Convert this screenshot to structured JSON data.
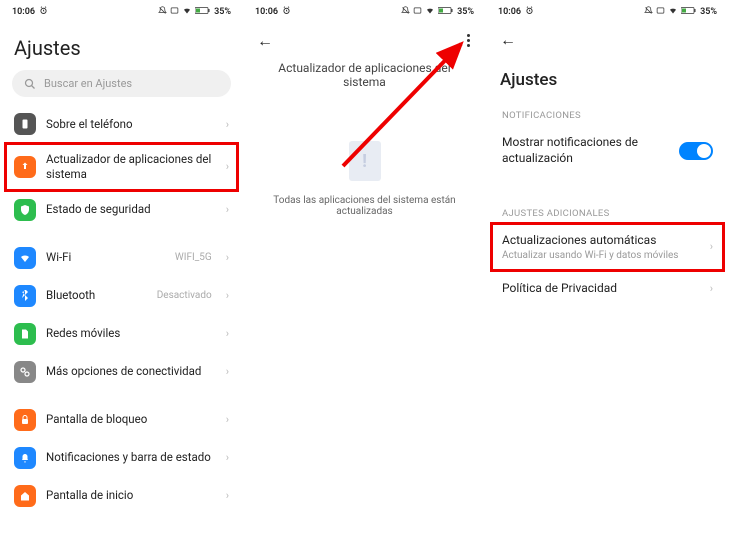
{
  "status": {
    "time": "10:06",
    "battery": "35%"
  },
  "screen1": {
    "title": "Ajustes",
    "search_placeholder": "Buscar en Ajustes",
    "items": {
      "about": "Sobre el teléfono",
      "updater": "Actualizador de aplicaciones del sistema",
      "security": "Estado de seguridad",
      "wifi": "Wi-Fi",
      "wifi_val": "WIFI_5G",
      "bluetooth": "Bluetooth",
      "bluetooth_val": "Desactivado",
      "mobile": "Redes móviles",
      "connectivity": "Más opciones de conectividad",
      "lock": "Pantalla de bloqueo",
      "notif": "Notificaciones y barra de estado",
      "home": "Pantalla de inicio"
    }
  },
  "screen2": {
    "header": "Actualizador de aplicaciones del sistema",
    "doc_mark": "!",
    "status": "Todas las aplicaciones del sistema están actualizadas"
  },
  "screen3": {
    "title": "Ajustes",
    "sections": {
      "notif": "NOTIFICACIONES",
      "additional": "AJUSTES ADICIONALES"
    },
    "show_notif": "Mostrar notificaciones de actualización",
    "auto_updates": "Actualizaciones automáticas",
    "auto_updates_sub": "Actualizar usando Wi-Fi y datos móviles",
    "privacy": "Política de Privacidad"
  }
}
